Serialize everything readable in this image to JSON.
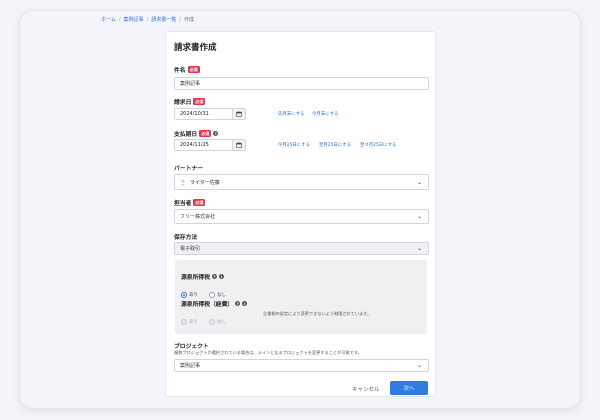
{
  "breadcrumb": {
    "items": [
      "ホーム",
      "案例記事",
      "請求書一覧",
      "作成"
    ]
  },
  "page": {
    "title": "請求書作成"
  },
  "subject": {
    "label": "件名",
    "required": "必須",
    "value": "案例記事"
  },
  "invoice_date": {
    "label": "請求日",
    "required": "必須",
    "value": "2024/10/31",
    "links": [
      "先月末にする",
      "今月末にする"
    ]
  },
  "due_date": {
    "label": "支払期日",
    "required": "必須",
    "value": "2024/11/25",
    "links": [
      "今月25日にする",
      "翌月25日にする",
      "翌々月25日にする"
    ]
  },
  "partner": {
    "label": "パートナー",
    "value": "ライター佐藤"
  },
  "owner": {
    "label": "担当者",
    "required": "必須",
    "value": "フリー株式会社"
  },
  "storage": {
    "label": "保存方法",
    "value": "電子取引"
  },
  "withholding": {
    "label": "源泉所得税",
    "options": [
      "あり",
      "なし"
    ],
    "selected": "あり"
  },
  "withholding_expense": {
    "label": "源泉所得税（経費）",
    "options": [
      "あり",
      "なし"
    ],
    "note": "企業側の設定により変更できないよう制限されています。"
  },
  "project": {
    "label": "プロジェクト",
    "description": "複数プロジェクトが選択されている場合は、メインとなるプロジェクトを変更することが可能です。",
    "value": "案例記事"
  },
  "actions": {
    "cancel": "キャンセル",
    "next": "次へ"
  },
  "colors": {
    "accent": "#2f7de1",
    "required": "#d93a4d",
    "link": "#2c6fd6"
  }
}
